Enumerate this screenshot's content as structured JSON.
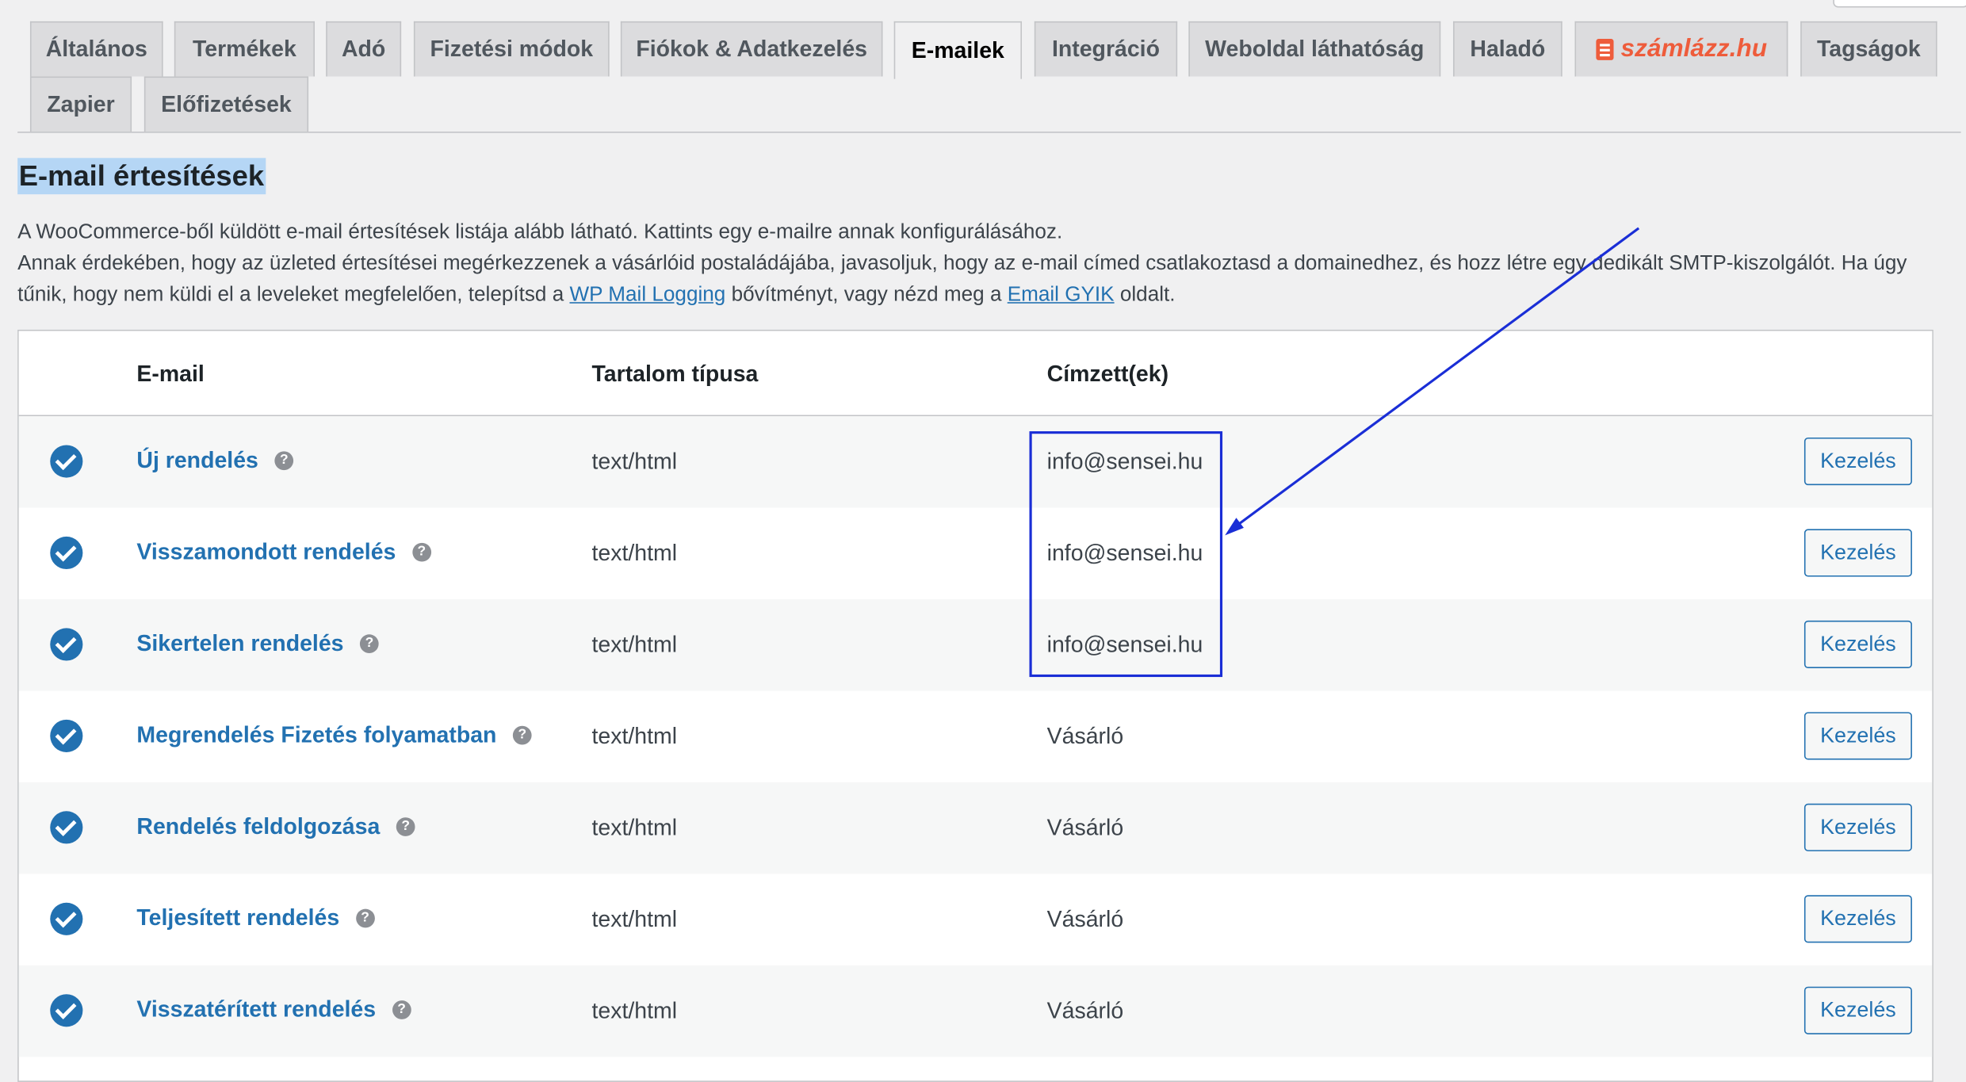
{
  "tabs": [
    {
      "label": "Általános",
      "active": false
    },
    {
      "label": "Termékek",
      "active": false
    },
    {
      "label": "Adó",
      "active": false
    },
    {
      "label": "Fizetési módok",
      "active": false
    },
    {
      "label": "Fiókok & Adatkezelés",
      "active": false
    },
    {
      "label": "E-mailek",
      "active": true
    },
    {
      "label": "Integráció",
      "active": false
    },
    {
      "label": "Weboldal láthatóság",
      "active": false
    },
    {
      "label": "Haladó",
      "active": false
    },
    {
      "label": "számlázz.hu",
      "active": false,
      "icon": "szamlazz-logo-icon",
      "color": "#ee5c3b"
    },
    {
      "label": "Tagságok",
      "active": false
    },
    {
      "label": "Zapier",
      "active": false
    },
    {
      "label": "Előfizetések",
      "active": false
    }
  ],
  "page": {
    "title": "E-mail értesítések",
    "desc_line1": "A WooCommerce-ből küldött e-mail értesítések listája alább látható. Kattints egy e-mailre annak konfigurálásához.",
    "desc_line2": "Annak érdekében, hogy az üzleted értesítései megérkezzenek a vásárlóid postaládájába, javasoljuk, hogy az e-mail címed csatlakoztasd a domainedhez, és hozz létre egy dedikált SMTP-kiszolgálót. Ha úgy tűnik, hogy nem küldi el a leveleket megfelelően, telepítsd a",
    "link1": "WP Mail Logging",
    "desc_mid": "bővítményt, vagy nézd meg a",
    "link2": "Email GYIK",
    "desc_end": "oldalt."
  },
  "table": {
    "headers": {
      "email": "E-mail",
      "content_type": "Tartalom típusa",
      "recipients": "Címzett(ek)"
    },
    "rows": [
      {
        "title": "Új rendelés",
        "content_type": "text/html",
        "recipient": "info@sensei.hu",
        "action": "Kezelés",
        "enabled": true
      },
      {
        "title": "Visszamondott rendelés",
        "content_type": "text/html",
        "recipient": "info@sensei.hu",
        "action": "Kezelés",
        "enabled": true
      },
      {
        "title": "Sikertelen rendelés",
        "content_type": "text/html",
        "recipient": "info@sensei.hu",
        "action": "Kezelés",
        "enabled": true
      },
      {
        "title": "Megrendelés Fizetés folyamatban",
        "content_type": "text/html",
        "recipient": "Vásárló",
        "action": "Kezelés",
        "enabled": true
      },
      {
        "title": "Rendelés feldolgozása",
        "content_type": "text/html",
        "recipient": "Vásárló",
        "action": "Kezelés",
        "enabled": true
      },
      {
        "title": "Teljesített rendelés",
        "content_type": "text/html",
        "recipient": "Vásárló",
        "action": "Kezelés",
        "enabled": true
      },
      {
        "title": "Visszatérített rendelés",
        "content_type": "text/html",
        "recipient": "Vásárló",
        "action": "Kezelés",
        "enabled": true
      }
    ]
  },
  "colors": {
    "accent": "#2271b1",
    "annotation": "#1a2ed6",
    "brand": "#ee5c3b"
  }
}
